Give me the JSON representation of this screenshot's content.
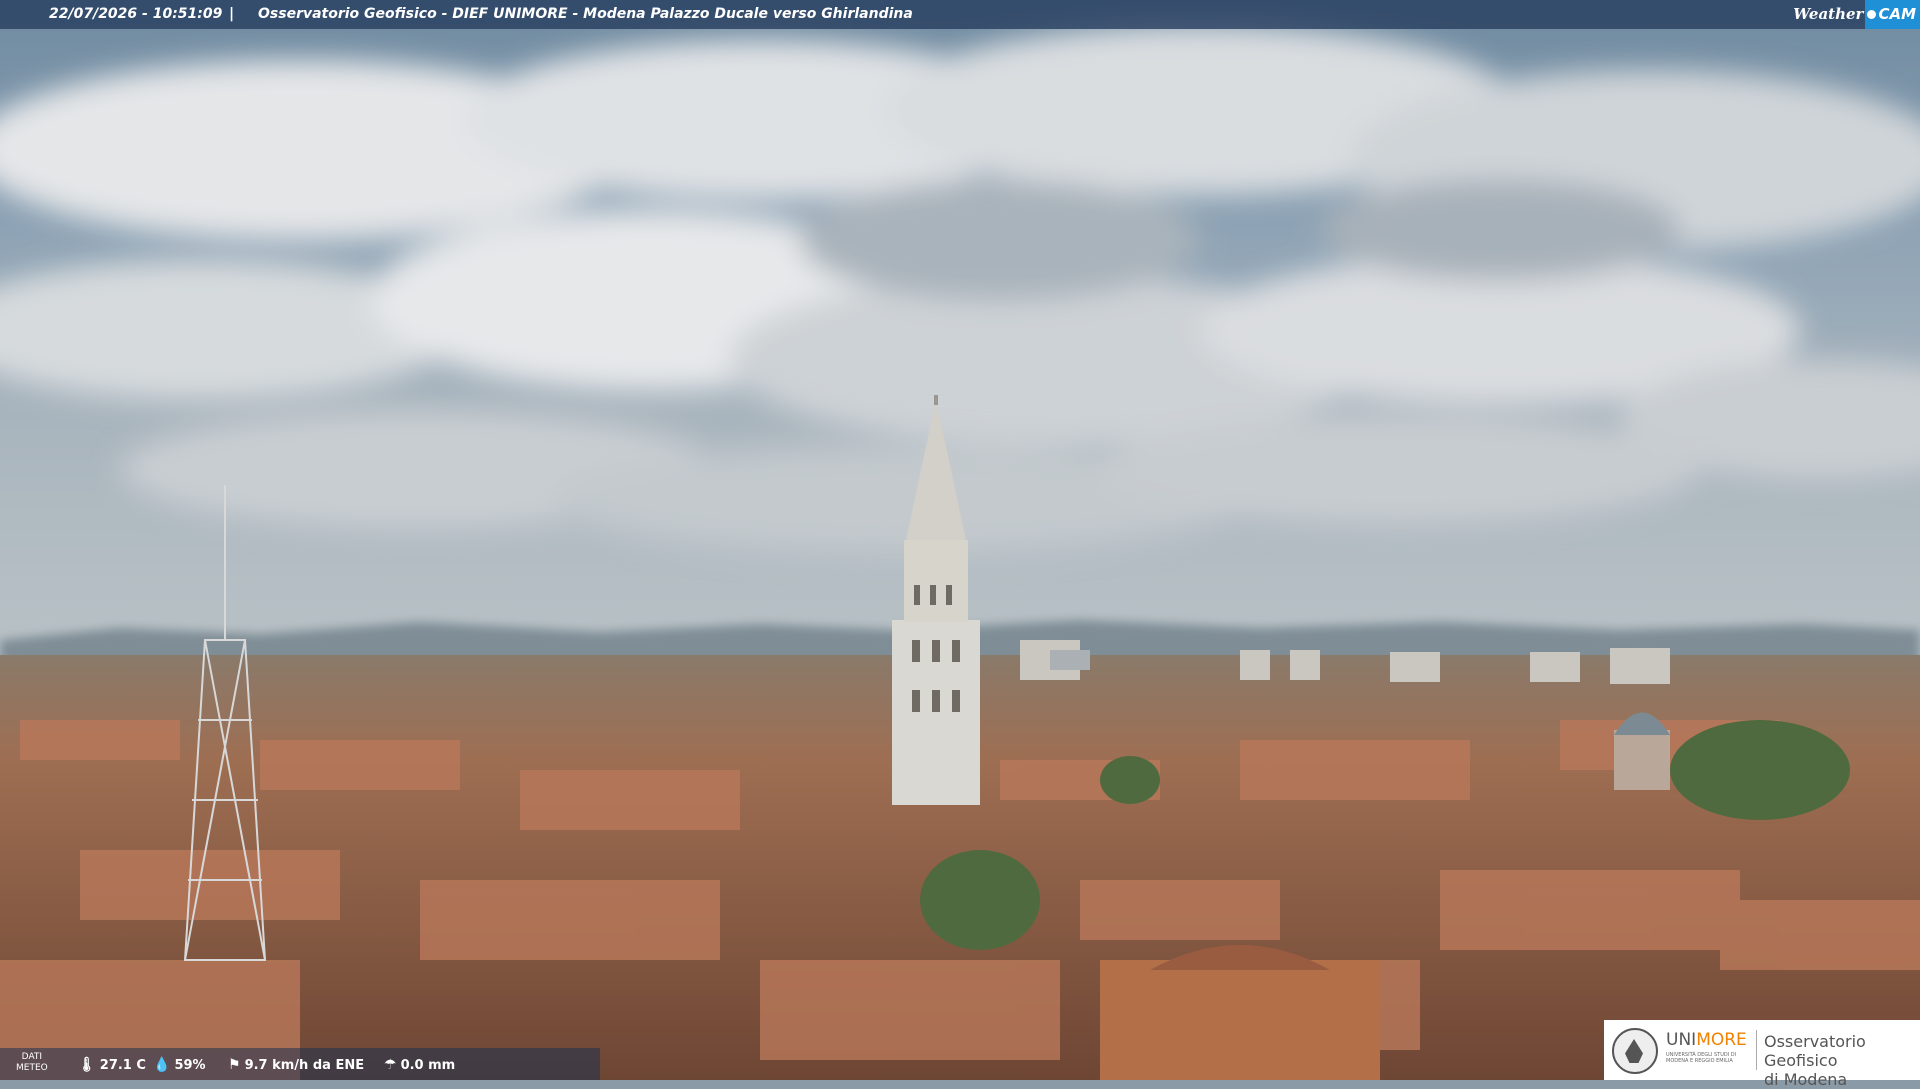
{
  "overlay": {
    "datetime": "22/07/2026 - 10:51:09",
    "separator": "|",
    "title": "Osservatorio Geofisico - DIEF UNIMORE - Modena Palazzo Ducale verso Ghirlandina",
    "brand_weather": "Weather",
    "brand_cam": "CAM"
  },
  "meteo": {
    "label_line1": "DATI",
    "label_line2": "METEO",
    "temperature": "27.1 C",
    "humidity": "59%",
    "wind": "9.7 km/h da ENE",
    "rain": "0.0 mm",
    "icons": [
      "thermometer-icon",
      "humidity-icon",
      "wind-icon",
      "rain-icon"
    ]
  },
  "logo": {
    "uni_part1": "UNI",
    "uni_part2": "MORE",
    "uni_sub": "UNIVERSITÀ DEGLI STUDI DI MODENA E REGGIO EMILIA",
    "org_line1": "Osservatorio Geofisico",
    "org_line2": "di Modena",
    "accent": "#f08200"
  },
  "colors": {
    "sky_top": "#5f7a93",
    "cloud": "#e6e8ea",
    "roof": "#a8664a",
    "tower": "#dcdcd6",
    "topbar": "#284060"
  }
}
